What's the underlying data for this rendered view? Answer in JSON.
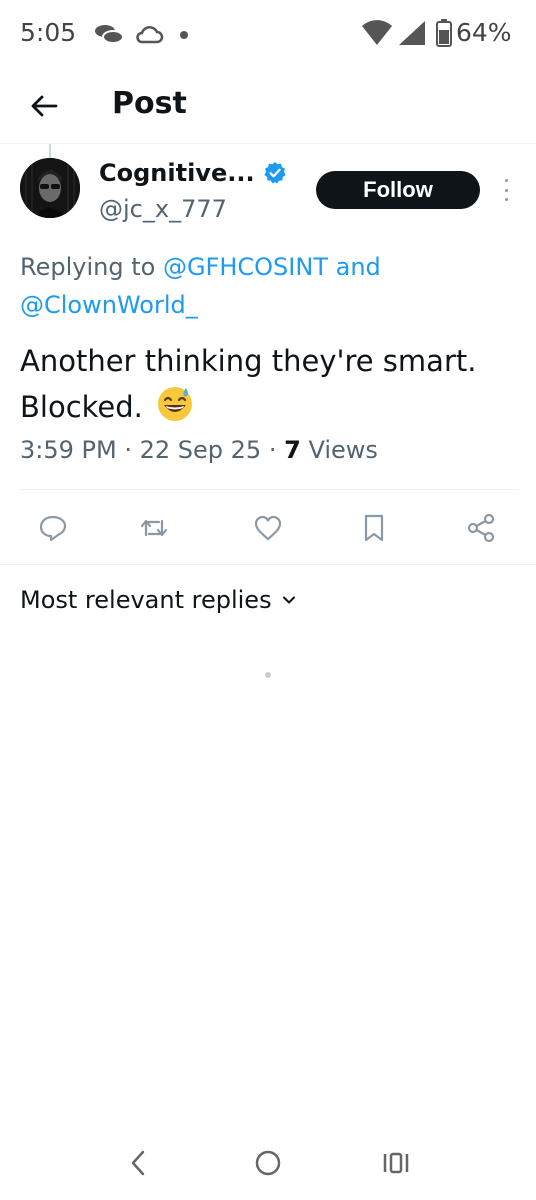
{
  "status_bar": {
    "time": "5:05",
    "battery": "64%",
    "icons": [
      "chat-bubbles-icon",
      "cloud-icon",
      "wifi-icon",
      "signal-icon",
      "battery-icon"
    ]
  },
  "header": {
    "title": "Post"
  },
  "post": {
    "author_name": "Cognitive...",
    "author_handle": "@jc_x_777",
    "follow_label": "Follow",
    "replying_prefix": "Replying to",
    "replying_mention_1": "@GFHCOSINT",
    "replying_and": "and",
    "replying_mention_2": "@ClownWorld_",
    "text": "Another thinking they're smart. Blocked.",
    "time": "3:59 PM",
    "date": "22 Sep 25",
    "views_count": "7",
    "views_label": "Views"
  },
  "replies": {
    "sort_label": "Most relevant replies"
  },
  "colors": {
    "accent": "#1d9bf0",
    "text": "#0f1419",
    "secondary_text": "#536471",
    "follow_bg": "#0f1419"
  }
}
